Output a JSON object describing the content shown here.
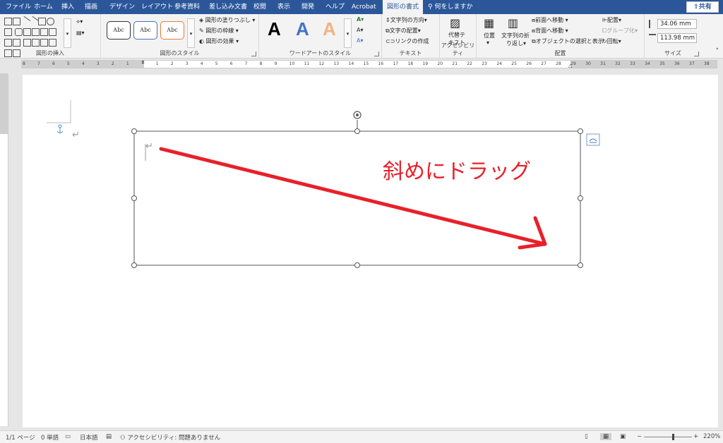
{
  "tabs": {
    "file": "ファイル",
    "home": "ホーム",
    "insert": "挿入",
    "draw": "描画",
    "design": "デザイン",
    "layout": "レイアウト",
    "references": "参考資料",
    "mailings": "差し込み文書",
    "review": "校閲",
    "view": "表示",
    "developer": "開発",
    "help": "ヘルプ",
    "acrobat": "Acrobat",
    "shape_format": "図形の書式",
    "tell_me": "何をしますか",
    "share": "共有"
  },
  "ribbon": {
    "insert_shapes": {
      "label": "図形の挿入"
    },
    "shape_styles": {
      "label": "図形のスタイル",
      "style_text": "Abc",
      "fill": "図形の塗りつぶし",
      "outline": "図形の枠線",
      "effects": "図形の効果"
    },
    "wordart": {
      "label": "ワードアートのスタイル",
      "letter": "A"
    },
    "text": {
      "label": "テキスト",
      "direction": "文字列の方向",
      "align": "文字の配置",
      "link": "リンクの作成"
    },
    "accessibility": {
      "label": "アクセシビリティ",
      "alt_text_1": "代替テ",
      "alt_text_2": "キスト"
    },
    "arrange": {
      "label": "配置",
      "position": "位置",
      "wrap_1": "文字列の折",
      "wrap_2": "り返し",
      "forward": "前面へ移動",
      "backward": "背面へ移動",
      "selection": "オブジェクトの選択と表示",
      "align": "配置",
      "group": "グループ化",
      "rotate": "回転"
    },
    "size": {
      "label": "サイズ",
      "height": "34.06 mm",
      "width": "113.98 mm"
    }
  },
  "ruler_numbers": [
    "8",
    "7",
    "6",
    "5",
    "4",
    "3",
    "2",
    "1",
    "",
    "1",
    "2",
    "3",
    "4",
    "5",
    "6",
    "7",
    "8",
    "9",
    "10",
    "11",
    "12",
    "13",
    "14",
    "15",
    "16",
    "17",
    "18",
    "19",
    "20",
    "21",
    "22",
    "23",
    "24",
    "25",
    "26",
    "27",
    "28",
    "29",
    "30",
    "31",
    "32",
    "33",
    "34",
    "35",
    "36",
    "37",
    "38"
  ],
  "document": {
    "annotation": "斜めにドラッグ",
    "paragraph_mark": "↵"
  },
  "status": {
    "page": "1/1 ページ",
    "words": "0 単語",
    "language": "日本語",
    "accessibility": "アクセシビリティ: 問題ありません",
    "zoom": "220%"
  },
  "colors": {
    "ribbon_blue": "#2b579a",
    "annotation_red": "#e8202a",
    "wordart_blue": "#4472c4",
    "wordart_orange": "#f4b183"
  }
}
